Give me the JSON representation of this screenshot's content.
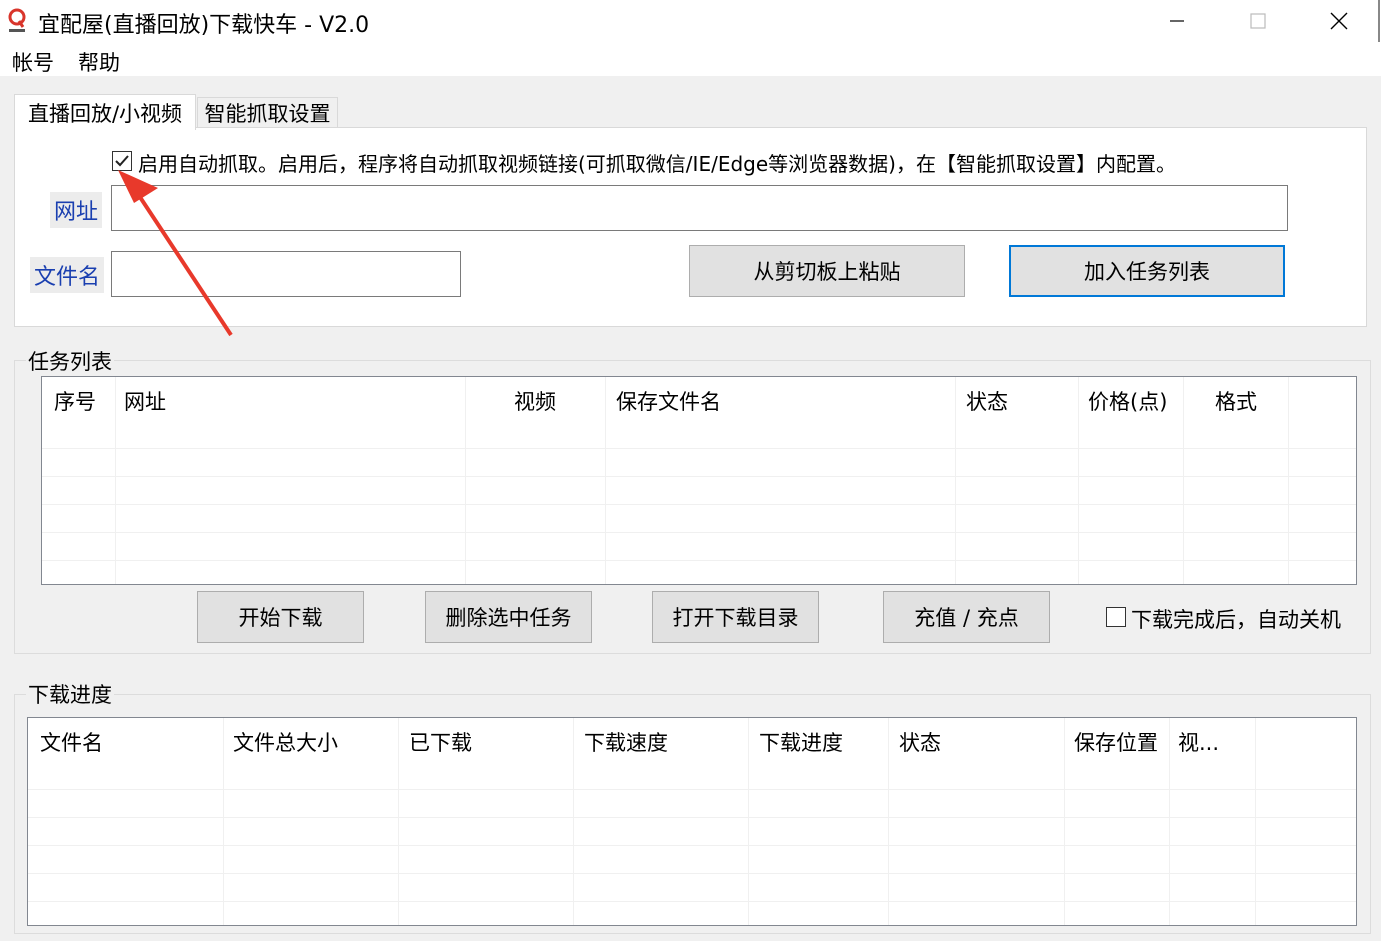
{
  "window": {
    "title": "宜配屋(直播回放)下载快车 - V2.0",
    "controls": [
      "minimize-icon",
      "maximize-icon",
      "close-icon"
    ]
  },
  "menu": {
    "items": [
      "帐号",
      "帮助"
    ]
  },
  "tabs": [
    {
      "label": "直播回放/小视频",
      "active": true
    },
    {
      "label": "智能抓取设置",
      "active": false
    }
  ],
  "capture": {
    "checked": true,
    "label": "启用自动抓取。启用后，程序将自动抓取视频链接(可抓取微信/IE/Edge等浏览器数据)，在【智能抓取设置】内配置。"
  },
  "form": {
    "url_label": "网址",
    "url_value": "",
    "filename_label": "文件名",
    "filename_value": "",
    "paste_button": "从剪切板上粘贴",
    "add_button": "加入任务列表"
  },
  "task_list": {
    "title": "任务列表",
    "columns": [
      "序号",
      "网址",
      "视频",
      "保存文件名",
      "状态",
      "价格(点)",
      "格式"
    ],
    "rows": [],
    "buttons": [
      "开始下载",
      "删除选中任务",
      "打开下载目录",
      "充值 / 充点"
    ],
    "shutdown_checked": false,
    "shutdown_label": "下载完成后，自动关机"
  },
  "progress": {
    "title": "下载进度",
    "columns": [
      "文件名",
      "文件总大小",
      "已下载",
      "下载速度",
      "下载进度",
      "状态",
      "保存位置",
      "视..."
    ],
    "rows": []
  },
  "colors": {
    "accent": "#0078d7",
    "label_blue": "#1a3fb0",
    "arrow": "#e8392b",
    "window_bg": "#f0f0f0"
  }
}
